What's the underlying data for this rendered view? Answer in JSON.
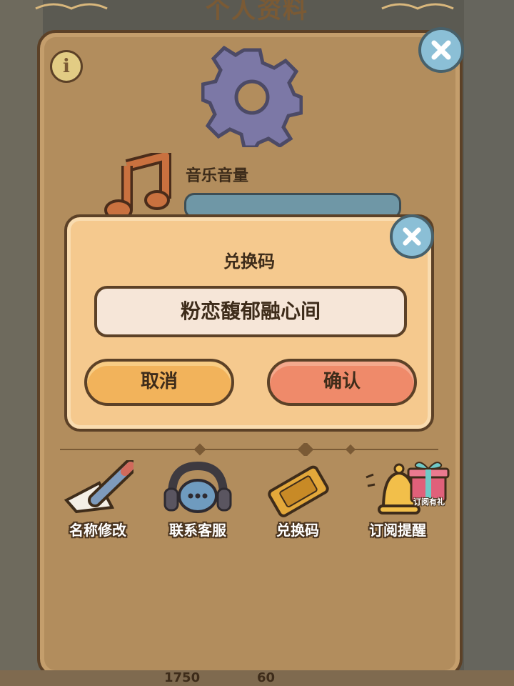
{
  "page": {
    "title": "个人资料"
  },
  "settings": {
    "music_label": "音乐音量",
    "music_volume": 0.95
  },
  "shortcuts": [
    {
      "label": "名称修改",
      "icon": "pencil-paper-icon"
    },
    {
      "label": "联系客服",
      "icon": "headset-icon"
    },
    {
      "label": "兑换码",
      "icon": "ticket-icon"
    },
    {
      "label": "订阅提醒",
      "icon": "bell-icon"
    }
  ],
  "gift": {
    "label": "订阅有礼"
  },
  "dialog": {
    "title": "兑换码",
    "code_value": "粉恋馥郁融心间",
    "cancel_label": "取消",
    "confirm_label": "确认"
  },
  "bottom_bar": {
    "coins": "1750",
    "gems": "60"
  },
  "colors": {
    "panel": "#b28d5d",
    "dialog": "#f5c98e",
    "cancel": "#f2b35b",
    "confirm": "#ef8a6a",
    "close": "#8bbfd6"
  }
}
